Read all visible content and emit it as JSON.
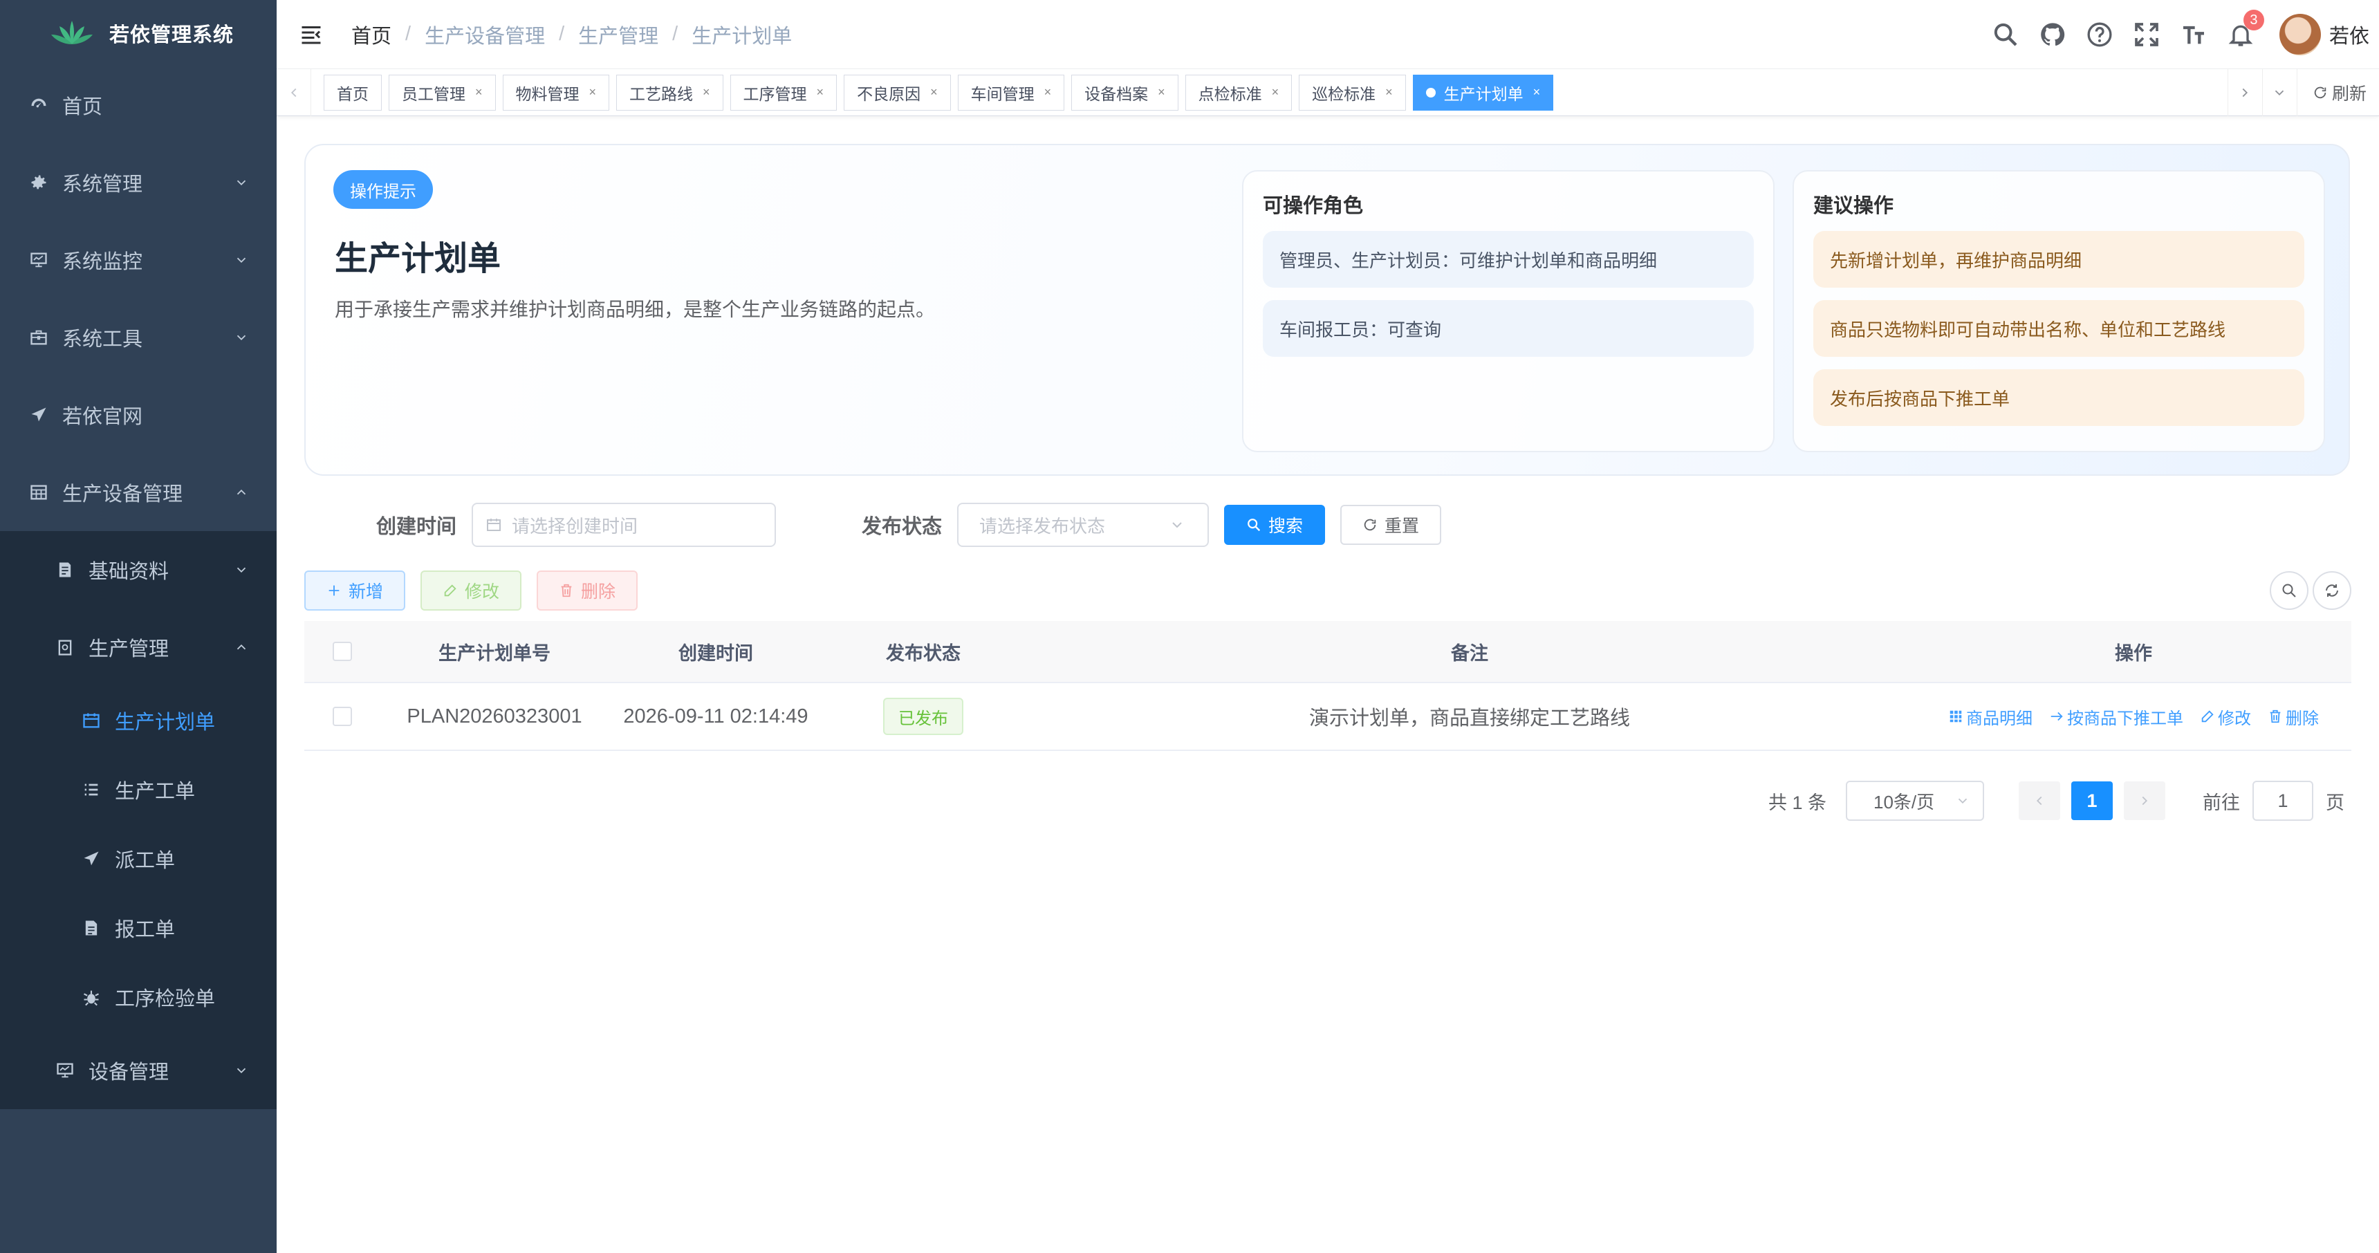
{
  "app": {
    "title": "若依管理系统"
  },
  "sidebar": {
    "items": [
      {
        "label": "首页",
        "icon": "dashboard-icon"
      },
      {
        "label": "系统管理",
        "icon": "gear-icon"
      },
      {
        "label": "系统监控",
        "icon": "monitor-icon"
      },
      {
        "label": "系统工具",
        "icon": "toolbox-icon"
      },
      {
        "label": "若依官网",
        "icon": "paper-plane-icon"
      },
      {
        "label": "生产设备管理",
        "icon": "table-icon"
      }
    ],
    "sub": [
      {
        "label": "基础资料"
      },
      {
        "label": "生产管理"
      }
    ],
    "leaf": [
      {
        "label": "生产计划单"
      },
      {
        "label": "生产工单"
      },
      {
        "label": "派工单"
      },
      {
        "label": "报工单"
      },
      {
        "label": "工序检验单"
      }
    ],
    "device": {
      "label": "设备管理"
    }
  },
  "breadcrumb": [
    "首页",
    "生产设备管理",
    "生产管理",
    "生产计划单"
  ],
  "navbar": {
    "notification_count": "3",
    "username": "若依"
  },
  "tags": [
    "首页",
    "员工管理",
    "物料管理",
    "工艺路线",
    "工序管理",
    "不良原因",
    "车间管理",
    "设备档案",
    "点检标准",
    "巡检标准"
  ],
  "active_tag": "生产计划单",
  "refresh_label": "刷新",
  "tip": {
    "pill": "操作提示",
    "title": "生产计划单",
    "desc": "用于承接生产需求并维护计划商品明细，是整个生产业务链路的起点。",
    "roles_title": "可操作角色",
    "roles": [
      "管理员、生产计划员：可维护计划单和商品明细",
      "车间报工员：可查询"
    ],
    "suggest_title": "建议操作",
    "suggest": [
      "先新增计划单，再维护商品明细",
      "商品只选物料即可自动带出名称、单位和工艺路线",
      "发布后按商品下推工单"
    ]
  },
  "search": {
    "created_label": "创建时间",
    "created_placeholder": "请选择创建时间",
    "status_label": "发布状态",
    "status_placeholder": "请选择发布状态",
    "search_btn": "搜索",
    "reset_btn": "重置"
  },
  "toolbar": {
    "add": "新增",
    "edit": "修改",
    "delete": "删除"
  },
  "table": {
    "headers": [
      "生产计划单号",
      "创建时间",
      "发布状态",
      "备注",
      "操作"
    ],
    "rows": [
      {
        "plan_no": "PLAN20260323001",
        "created": "2026-09-11 02:14:49",
        "status": "已发布",
        "remark": "演示计划单，商品直接绑定工艺路线"
      }
    ],
    "ops": [
      "商品明细",
      "按商品下推工单",
      "修改",
      "删除"
    ]
  },
  "pagination": {
    "total": "共 1 条",
    "page_size": "10条/页",
    "current": "1",
    "goto_label": "前往",
    "goto_value": "1",
    "page_suffix": "页"
  },
  "colors": {
    "sidebar_bg": "#304156",
    "submenu_bg": "#1f2d3d",
    "primary": "#409eff",
    "success": "#67c23a",
    "danger": "#f56c6c"
  }
}
